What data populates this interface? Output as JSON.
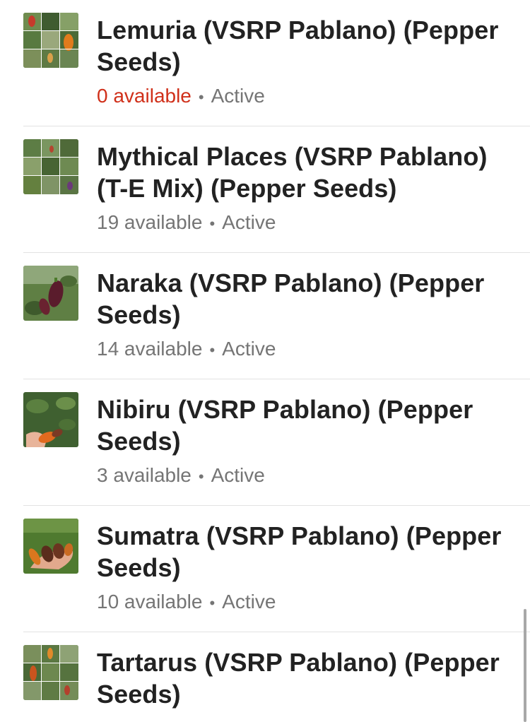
{
  "listings": [
    {
      "title": "Lemuria (VSRP Pablano) (Pepper Seeds)",
      "available": "0 available",
      "available_count": 0,
      "separator": "•",
      "status": "Active",
      "thumbnail": "pepper-collage-thumbnail"
    },
    {
      "title": "Mythical Places (VSRP Pablano) (T-E Mix) (Pepper Seeds)",
      "available": "19 available",
      "available_count": 19,
      "separator": "•",
      "status": "Active",
      "thumbnail": "pepper-collage-thumbnail"
    },
    {
      "title": "Naraka (VSRP Pablano) (Pepper Seeds)",
      "available": "14 available",
      "available_count": 14,
      "separator": "•",
      "status": "Active",
      "thumbnail": "dark-pepper-plant-thumbnail"
    },
    {
      "title": "Nibiru (VSRP Pablano) (Pepper Seeds)",
      "available": "3 available",
      "available_count": 3,
      "separator": "•",
      "status": "Active",
      "thumbnail": "pepper-in-hand-thumbnail"
    },
    {
      "title": "Sumatra (VSRP Pablano) (Pepper Seeds)",
      "available": "10 available",
      "available_count": 10,
      "separator": "•",
      "status": "Active",
      "thumbnail": "peppers-on-palm-thumbnail"
    },
    {
      "title": "Tartarus (VSRP Pablano) (Pepper Seeds)",
      "available": "",
      "available_count": null,
      "separator": "",
      "status": "",
      "thumbnail": "pepper-collage-thumbnail"
    }
  ],
  "colors": {
    "title": "#222222",
    "meta": "#757575",
    "out_of_stock": "#d0301a",
    "divider": "#e2e2e2"
  }
}
